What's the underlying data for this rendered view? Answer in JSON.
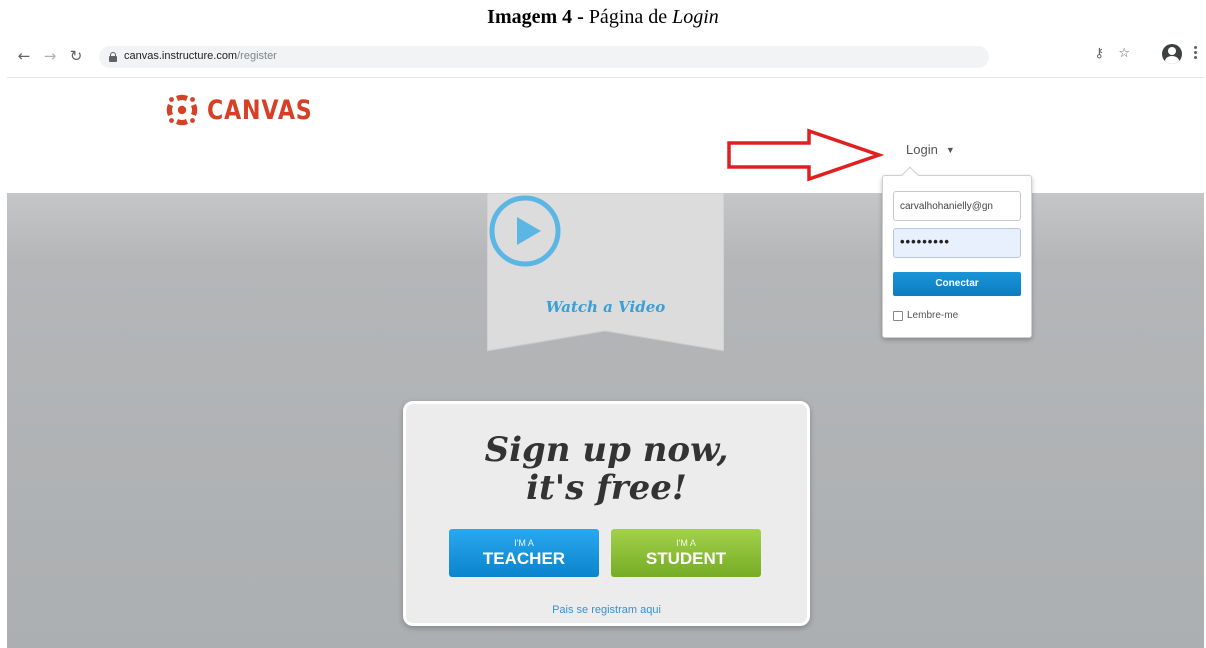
{
  "caption": {
    "label": "Imagem 4 -",
    "text": " Página de ",
    "emphasis": "Login"
  },
  "browser": {
    "url_host": "canvas.instructure.com",
    "url_path": "/register",
    "icons": [
      "back-icon",
      "forward-icon",
      "reload-icon",
      "lock-icon",
      "key-icon",
      "star-icon",
      "account-icon",
      "menu-icon"
    ]
  },
  "header": {
    "logo_text": "CANVAS",
    "login_label": "Login",
    "brand_color": "#d64027"
  },
  "video_banner": {
    "label": "Watch a Video",
    "accent": "#3a9fd6"
  },
  "login_popup": {
    "email_value": "carvalhohanielly@gn",
    "password_value": "•••••••••",
    "connect_label": "Conectar",
    "remember_label": "Lembre-me",
    "remember_checked": false
  },
  "signup": {
    "title_line1": "Sign up now,",
    "title_line2": "it's free!",
    "teacher_small": "I'M A",
    "teacher_big": "TEACHER",
    "student_small": "I'M A",
    "student_big": "STUDENT",
    "parents_link": "Pais se registram aqui"
  },
  "colors": {
    "teacher": "#0a84cc",
    "student": "#76ac26",
    "connect": "#1a95d8",
    "arrow": "#e02020"
  }
}
